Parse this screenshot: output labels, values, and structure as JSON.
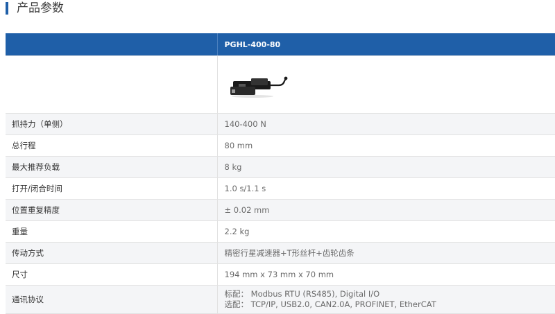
{
  "section": {
    "title": "产品参数"
  },
  "table": {
    "header_label": "",
    "model": "PGHL-400-80",
    "rows": [
      {
        "label": "抓持力（单侧）",
        "value": "140-400 N"
      },
      {
        "label": "总行程",
        "value": "80 mm"
      },
      {
        "label": "最大推荐负载",
        "value": "8 kg"
      },
      {
        "label": "打开/闭合时间",
        "value": "1.0 s/1.1 s"
      },
      {
        "label": "位置重复精度",
        "value": "± 0.02 mm"
      },
      {
        "label": "重量",
        "value": "2.2 kg"
      },
      {
        "label": "传动方式",
        "value": "精密行星减速器+T形丝杆+齿轮齿条"
      },
      {
        "label": "尺寸",
        "value": "194 mm x 73 mm x 70 mm"
      }
    ],
    "protocol": {
      "label": "通讯协议",
      "standard": "标配：  Modbus RTU (RS485), Digital I/O",
      "optional": "选配：  TCP/IP, USB2.0, CAN2.0A, PROFINET, EtherCAT"
    }
  },
  "colors": {
    "accent": "#1f5fa8",
    "row_alt": "#f4f5f7",
    "value_text": "#6a6a6a"
  },
  "icons": {
    "product": "electric-gripper-image"
  }
}
